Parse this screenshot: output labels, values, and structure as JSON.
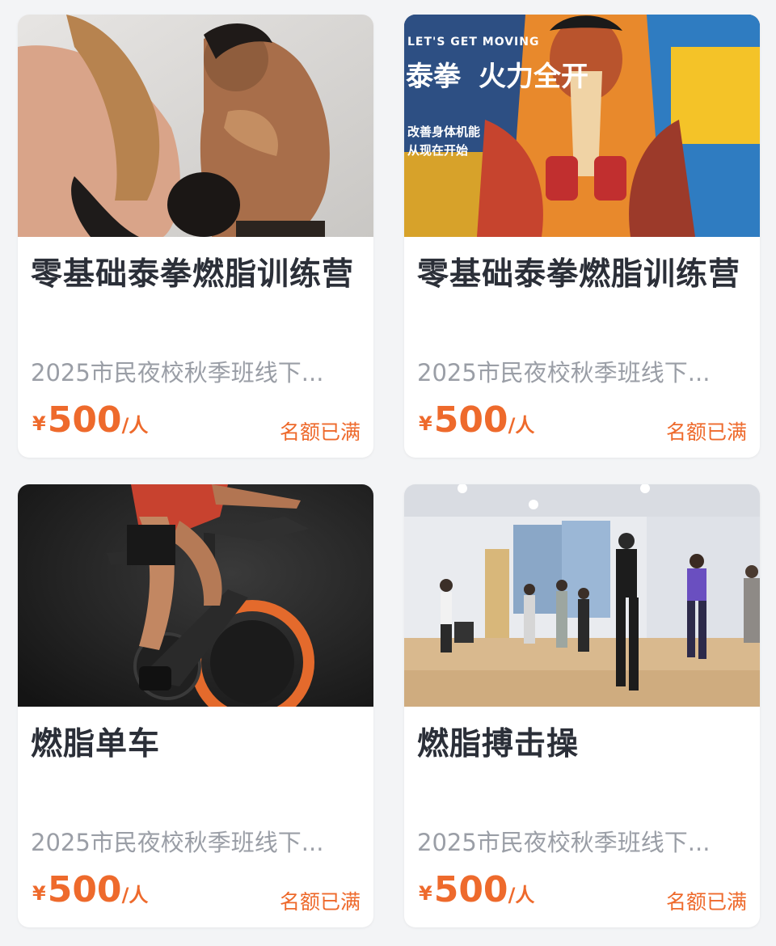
{
  "courses": [
    {
      "image": "muay-thai-sparring-photo",
      "image_text": [],
      "title": "零基础泰拳燃脂训练营",
      "subtitle": "2025市民夜校秋季班线下...",
      "currency": "¥",
      "price": "500",
      "unit": "/人",
      "status": "名额已满"
    },
    {
      "image": "muay-thai-poster-graffiti",
      "image_text": [
        "LET'S GET MOVING",
        "泰拳",
        "火力全开",
        "改善身体机能",
        "从现在开始"
      ],
      "title": "零基础泰拳燃脂训练营",
      "subtitle": "2025市民夜校秋季班线下...",
      "currency": "¥",
      "price": "500",
      "unit": "/人",
      "status": "名额已满"
    },
    {
      "image": "spin-bike-photo",
      "image_text": [],
      "title": "燃脂单车",
      "subtitle": "2025市民夜校秋季班线下...",
      "currency": "¥",
      "price": "500",
      "unit": "/人",
      "status": "名额已满"
    },
    {
      "image": "kickboxing-aerobics-class-photo",
      "image_text": [],
      "title": "燃脂搏击操",
      "subtitle": "2025市民夜校秋季班线下...",
      "currency": "¥",
      "price": "500",
      "unit": "/人",
      "status": "名额已满"
    }
  ],
  "colors": {
    "accent": "#ee6a2c",
    "title": "#2b2f38",
    "muted": "#9a9ea6",
    "card_bg": "#ffffff",
    "page_bg": "#f3f4f6"
  }
}
